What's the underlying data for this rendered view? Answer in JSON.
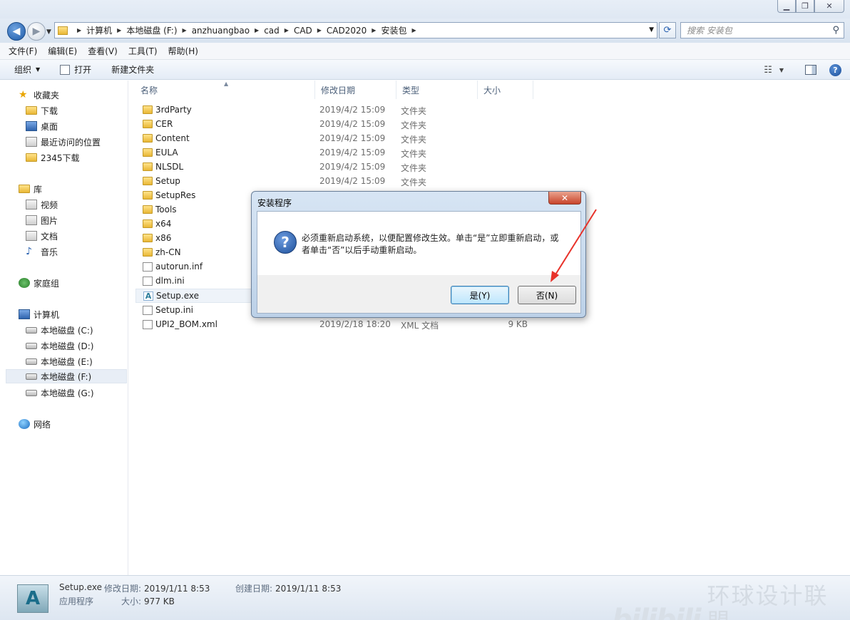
{
  "address": {
    "crumbs": [
      "计算机",
      "本地磁盘 (F:)",
      "anzhuangbao",
      "cad",
      "CAD",
      "CAD2020",
      "安装包"
    ],
    "search_placeholder": "搜索 安装包"
  },
  "menu": [
    "文件(F)",
    "编辑(E)",
    "查看(V)",
    "工具(T)",
    "帮助(H)"
  ],
  "commands": {
    "organize": "组织",
    "open": "打开",
    "new_folder": "新建文件夹"
  },
  "nav": {
    "favorites": "收藏夹",
    "fav_items": [
      "下载",
      "桌面",
      "最近访问的位置",
      "2345下载"
    ],
    "library": "库",
    "lib_items": [
      "视频",
      "图片",
      "文档",
      "音乐"
    ],
    "homegroup": "家庭组",
    "computer": "计算机",
    "drives": [
      "本地磁盘 (C:)",
      "本地磁盘 (D:)",
      "本地磁盘 (E:)",
      "本地磁盘 (F:)",
      "本地磁盘 (G:)"
    ],
    "network": "网络"
  },
  "columns": [
    "名称",
    "修改日期",
    "类型",
    "大小"
  ],
  "files": [
    {
      "name": "3rdParty",
      "date": "2019/4/2 15:09",
      "type": "文件夹",
      "size": "",
      "icon": "folder-icon"
    },
    {
      "name": "CER",
      "date": "2019/4/2 15:09",
      "type": "文件夹",
      "size": "",
      "icon": "folder-icon"
    },
    {
      "name": "Content",
      "date": "2019/4/2 15:09",
      "type": "文件夹",
      "size": "",
      "icon": "folder-icon"
    },
    {
      "name": "EULA",
      "date": "2019/4/2 15:09",
      "type": "文件夹",
      "size": "",
      "icon": "folder-icon"
    },
    {
      "name": "NLSDL",
      "date": "2019/4/2 15:09",
      "type": "文件夹",
      "size": "",
      "icon": "folder-icon"
    },
    {
      "name": "Setup",
      "date": "2019/4/2 15:09",
      "type": "文件夹",
      "size": "",
      "icon": "folder-icon"
    },
    {
      "name": "SetupRes",
      "date": "",
      "type": "",
      "size": "",
      "icon": "folder-icon"
    },
    {
      "name": "Tools",
      "date": "",
      "type": "",
      "size": "",
      "icon": "folder-icon"
    },
    {
      "name": "x64",
      "date": "",
      "type": "",
      "size": "",
      "icon": "folder-icon"
    },
    {
      "name": "x86",
      "date": "",
      "type": "",
      "size": "",
      "icon": "folder-icon"
    },
    {
      "name": "zh-CN",
      "date": "",
      "type": "",
      "size": "",
      "icon": "folder-icon"
    },
    {
      "name": "autorun.inf",
      "date": "",
      "type": "",
      "size": "",
      "icon": "settings-file-icon"
    },
    {
      "name": "dlm.ini",
      "date": "",
      "type": "",
      "size": "",
      "icon": "settings-file-icon"
    },
    {
      "name": "Setup.exe",
      "date": "",
      "type": "",
      "size": "",
      "icon": "autodesk-exe-icon"
    },
    {
      "name": "Setup.ini",
      "date": "",
      "type": "",
      "size": "",
      "icon": "settings-file-icon"
    },
    {
      "name": "UPI2_BOM.xml",
      "date": "2019/2/18 18:20",
      "type": "XML 文档",
      "size": "9 KB",
      "icon": "file-icon"
    }
  ],
  "status": {
    "filename": "Setup.exe",
    "modified_label": "修改日期:",
    "modified": "2019/1/11 8:53",
    "created_label": "创建日期:",
    "created": "2019/1/11 8:53",
    "kind": "应用程序",
    "size_label": "大小:",
    "size": "977 KB"
  },
  "dialog": {
    "title": "安装程序",
    "message": "必须重新启动系统，以便配置修改生效。单击“是”立即重新启动，或者单击“否”以后手动重新启动。",
    "yes": "是(Y)",
    "no": "否(N)"
  },
  "watermark": {
    "brand": "bilibili",
    "text": "环球设计联盟"
  }
}
